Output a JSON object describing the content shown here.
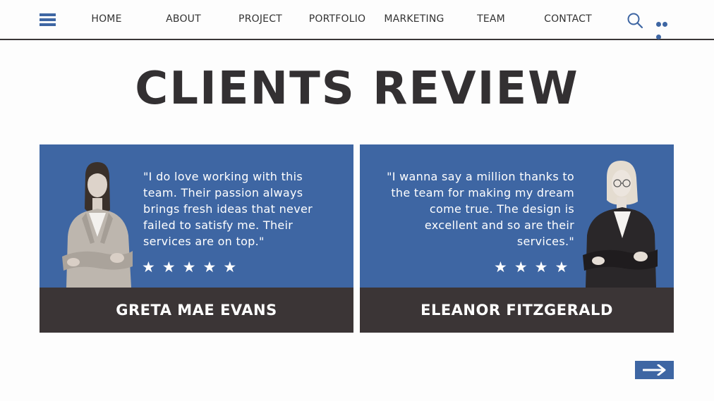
{
  "nav": {
    "menu_icon": "hamburger-icon",
    "items": [
      {
        "label": "HOME"
      },
      {
        "label": "ABOUT"
      },
      {
        "label": "PROJECT"
      },
      {
        "label": "PORTFOLIO"
      },
      {
        "label": "MARKETING"
      },
      {
        "label": "TEAM"
      },
      {
        "label": "CONTACT"
      }
    ],
    "search_icon": "search-icon",
    "more_icon": "more-dots-icon"
  },
  "page": {
    "title": "CLIENTS REVIEW"
  },
  "reviews": [
    {
      "quote": "\"I do love working with this team. Their passion always brings fresh ideas that never failed to satisfy me. Their services are on top.\"",
      "rating": 5,
      "stars": "★★★★★",
      "name": "GRETA MAE EVANS"
    },
    {
      "quote": "\"I wanna say a million thanks to the team for making my dream come true. The design is excellent and so are their services.\"",
      "rating": 4,
      "stars": "★★★★",
      "name": "ELEANOR FITZGERALD"
    }
  ],
  "next_button": {
    "icon": "arrow-right-icon"
  },
  "colors": {
    "accent_blue": "#3e66a3",
    "dark_bar": "#3b3536",
    "title_text": "#333032",
    "background": "#fdfdfd"
  }
}
